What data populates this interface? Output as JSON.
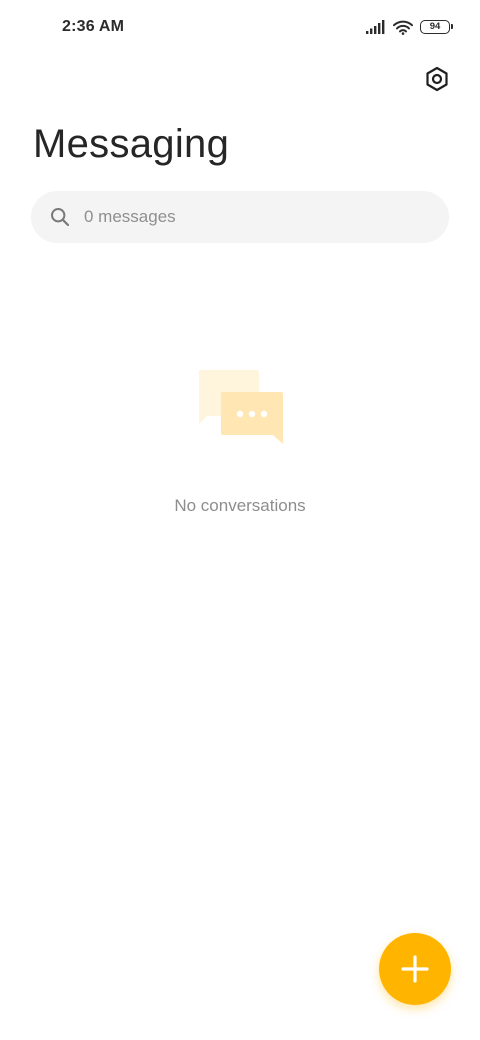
{
  "status_bar": {
    "time": "2:36 AM",
    "battery_level": "94",
    "icons": [
      "signal-icon",
      "wifi-icon",
      "battery-icon"
    ]
  },
  "header": {
    "title": "Messaging",
    "settings_icon": "gear-icon"
  },
  "search": {
    "placeholder": "0 messages",
    "icon": "search-icon"
  },
  "empty_state": {
    "icon": "conversations-icon",
    "text": "No conversations"
  },
  "fab": {
    "icon": "plus-icon",
    "color": "#ffb400"
  },
  "colors": {
    "accent": "#ffb400",
    "background": "#ffffff",
    "search_background": "#f4f4f4",
    "muted_text": "#8d8d8d"
  }
}
